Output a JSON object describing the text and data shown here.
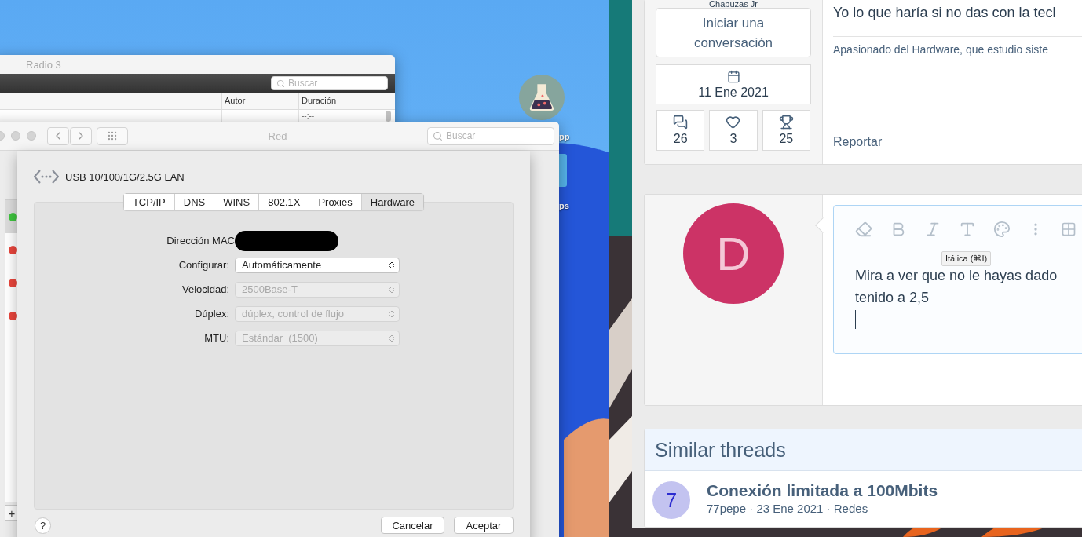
{
  "desktop": {
    "icons": [
      {
        "label": "pp"
      },
      {
        "label": "ps"
      }
    ]
  },
  "music_window": {
    "title": "Radio 3",
    "search": {
      "placeholder": "Buscar"
    },
    "columns": [
      "Autor",
      "Duración"
    ],
    "rows": [
      {
        "duration": "--:--"
      }
    ]
  },
  "network_window": {
    "title": "Red",
    "search": {
      "placeholder": "Buscar"
    },
    "services": [
      {
        "color": "#3ec43e",
        "selected": true
      },
      {
        "color": "#e8453c",
        "selected": false
      },
      {
        "color": "#e8453c",
        "selected": false
      },
      {
        "color": "#e8453c",
        "selected": false
      }
    ],
    "add_button": "+",
    "sheet": {
      "interface": "USB 10/100/1G/2.5G LAN",
      "tabs": [
        {
          "label": "TCP/IP",
          "selected": false
        },
        {
          "label": "DNS",
          "selected": false
        },
        {
          "label": "WINS",
          "selected": false
        },
        {
          "label": "802.1X",
          "selected": false
        },
        {
          "label": "Proxies",
          "selected": false
        },
        {
          "label": "Hardware",
          "selected": true
        }
      ],
      "fields": [
        {
          "kind": "redacted",
          "label": "Dirección MAC"
        },
        {
          "kind": "select",
          "label": "Configurar:",
          "value": "Automáticamente",
          "disabled": false
        },
        {
          "kind": "select",
          "label": "Velocidad:",
          "value": "2500Base-T",
          "disabled": true
        },
        {
          "kind": "select",
          "label": "Dúplex:",
          "value": "dúplex, control de flujo",
          "disabled": true
        },
        {
          "kind": "select",
          "label": "MTU:",
          "value": "Estándar  (1500)",
          "disabled": true
        }
      ],
      "help": "?",
      "buttons": [
        "Cancelar",
        "Aceptar"
      ]
    }
  },
  "forum": {
    "post": {
      "author": "Chapuzas Jr",
      "start_conversation": "Iniciar una conversación",
      "joined": "11 Ene 2021",
      "stats": [
        {
          "kind": "messages",
          "value": "26"
        },
        {
          "kind": "reactions",
          "value": "3"
        },
        {
          "kind": "points",
          "value": "25"
        }
      ],
      "message": "Yo lo que haría si no das con la tecl",
      "signature": "Apasionado del Hardware, que estudio siste",
      "report": "Reportar"
    },
    "reply": {
      "avatar_letter": "D",
      "tooltip": "Itálica (⌘I)",
      "lines": [
        "Mira a ver que no le hayas dado",
        "tenido a 2,5"
      ]
    },
    "similar_threads": {
      "title": "Similar threads",
      "threads": [
        {
          "badge": "7",
          "title": "Conexión limitada a 100Mbits",
          "meta": "77pepe · 23 Ene 2021 · Redes"
        }
      ]
    }
  }
}
